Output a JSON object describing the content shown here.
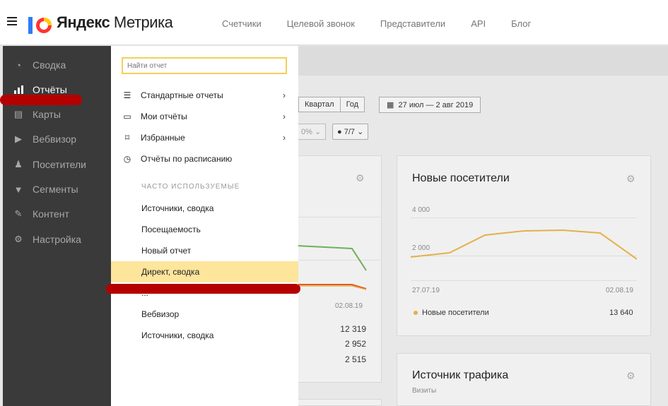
{
  "header": {
    "brand_bold": "Яндекс",
    "brand_light": "Метрика",
    "nav": [
      "Счетчики",
      "Целевой звонок",
      "Представители",
      "API",
      "Блог"
    ]
  },
  "sidebar": {
    "items": [
      {
        "label": "Сводка",
        "icon": "dashboard-icon"
      },
      {
        "label": "Отчёты",
        "icon": "bar-chart-icon",
        "active": true
      },
      {
        "label": "Карты",
        "icon": "map-icon"
      },
      {
        "label": "Вебвизор",
        "icon": "play-icon"
      },
      {
        "label": "Посетители",
        "icon": "person-icon"
      },
      {
        "label": "Сегменты",
        "icon": "filter-icon"
      },
      {
        "label": "Контент",
        "icon": "pencil-icon"
      },
      {
        "label": "Настройка",
        "icon": "gear-icon"
      }
    ]
  },
  "menu": {
    "search_placeholder": "Найти отчет",
    "items": [
      {
        "label": "Стандартные отчеты",
        "icon": "list-icon",
        "has_arrow": true
      },
      {
        "label": "Мои отчёты",
        "icon": "monitor-icon",
        "has_arrow": true
      },
      {
        "label": "Избранные",
        "icon": "bookmark-icon",
        "has_arrow": true
      },
      {
        "label": "Отчёты по расписанию",
        "icon": "clock-icon",
        "has_arrow": false
      }
    ],
    "frequent_header": "ЧАСТО ИСПОЛЬЗУЕМЫЕ",
    "frequent": [
      "Источники, сводка",
      "Посещаемость",
      "Новый отчет",
      "Директ, сводка",
      "...",
      "Вебвизор",
      "Источники, сводка"
    ],
    "highlighted_index": 3
  },
  "background": {
    "period_buttons": [
      "Квартал",
      "Год"
    ],
    "date_range": "27 июл — 2 авг 2019",
    "sel1": "0%",
    "sel2": "7/7",
    "card1": {
      "date": "02.08.19",
      "values": [
        "12 319",
        "2 952",
        "2 515"
      ]
    },
    "card2": {
      "title": "Новые посетители",
      "y_ticks": [
        "4 000",
        "2 000"
      ],
      "x_ticks": [
        "27.07.19",
        "02.08.19"
      ],
      "legend": "Новые посетители",
      "total": "13 640"
    },
    "card3": {
      "title": "Источник трафика",
      "subtitle": "Визиты"
    }
  },
  "colors": {
    "accent_yellow": "#f4cf5a",
    "highlight": "#fde59c",
    "sidebar_bg": "#3a3a3a",
    "annotation_red": "#b50000",
    "line_orange": "#e4b04a"
  }
}
